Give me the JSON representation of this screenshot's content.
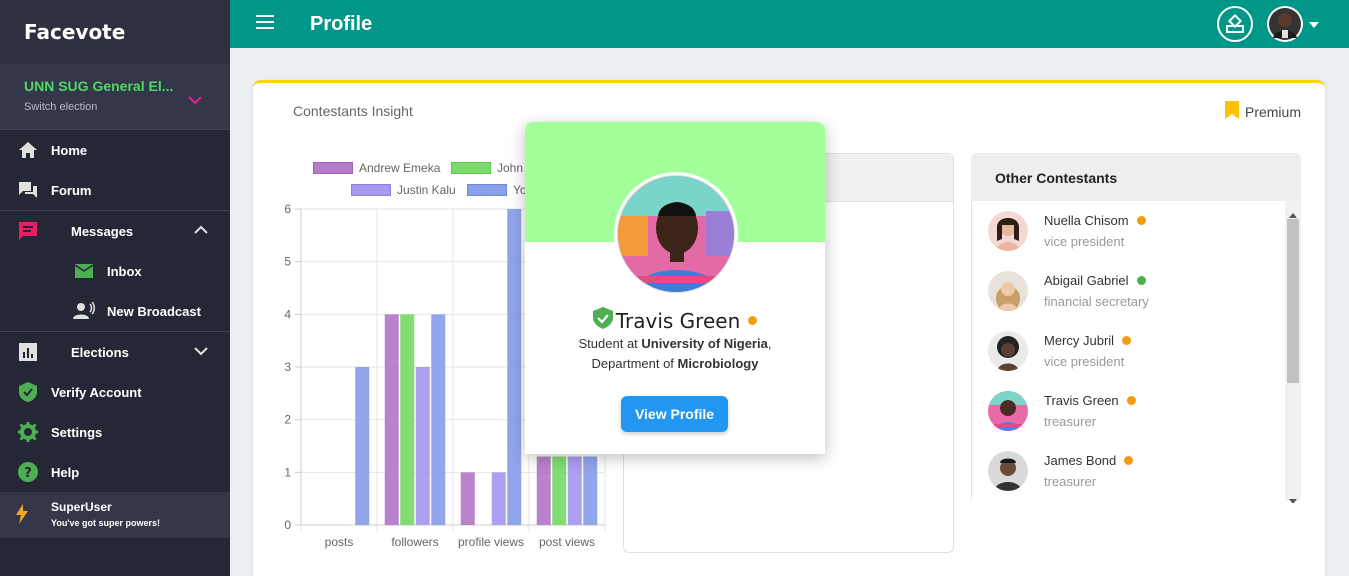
{
  "app": {
    "brand": "Facevote"
  },
  "election": {
    "name": "UNN SUG General El...",
    "switch_label": "Switch election"
  },
  "sidebar": {
    "items": [
      {
        "label": "Home",
        "icon": "home-icon"
      },
      {
        "label": "Forum",
        "icon": "forum-icon"
      },
      {
        "label": "Messages",
        "icon": "messages-icon"
      },
      {
        "label": "Inbox",
        "icon": "mail-icon"
      },
      {
        "label": "New Broadcast",
        "icon": "broadcast-icon"
      },
      {
        "label": "Elections",
        "icon": "bar-chart-icon"
      },
      {
        "label": "Verify Account",
        "icon": "shield-check-icon"
      },
      {
        "label": "Settings",
        "icon": "gear-icon"
      },
      {
        "label": "Help",
        "icon": "help-icon"
      }
    ],
    "superuser": {
      "title": "SuperUser",
      "subtitle": "You've got super powers!"
    }
  },
  "topbar": {
    "title": "Profile"
  },
  "card": {
    "title": "Contestants Insight",
    "premium_label": "Premium"
  },
  "chart_data": {
    "type": "bar",
    "categories": [
      "posts",
      "followers",
      "profile views",
      "post views"
    ],
    "ylim": [
      0,
      6
    ],
    "yticks": [
      "0",
      "1",
      "2",
      "3",
      "4",
      "5",
      "6"
    ],
    "series": [
      {
        "name": "Andrew Emeka",
        "color": "#b47cc8",
        "values": [
          0,
          4,
          1,
          1.3
        ]
      },
      {
        "name": "John",
        "color": "#7bdc6a",
        "values": [
          0,
          4,
          0,
          1.3
        ]
      },
      {
        "name": "Justin Kalu",
        "color": "#a99af0",
        "values": [
          0,
          3,
          1,
          1.3
        ]
      },
      {
        "name": "Yo",
        "color": "#8aa0ea",
        "values": [
          3,
          4,
          6,
          1.3
        ]
      }
    ]
  },
  "others": {
    "title": "Other Contestants",
    "items": [
      {
        "name": "Nuella Chisom",
        "role": "vice president",
        "status_color": "#f39c12"
      },
      {
        "name": "Abigail Gabriel",
        "role": "financial secretary",
        "status_color": "#4caf50"
      },
      {
        "name": "Mercy Jubril",
        "role": "vice president",
        "status_color": "#f39c12"
      },
      {
        "name": "Travis Green",
        "role": "treasurer",
        "status_color": "#f39c12"
      },
      {
        "name": "James Bond",
        "role": "treasurer",
        "status_color": "#f39c12"
      }
    ]
  },
  "popup": {
    "name": "Travis Green",
    "line1_prefix": "Student at ",
    "line1_bold": "University of Nigeria",
    "line1_suffix": ",",
    "line2_prefix": "Department of ",
    "line2_bold": "Microbiology",
    "button_label": "View Profile"
  }
}
